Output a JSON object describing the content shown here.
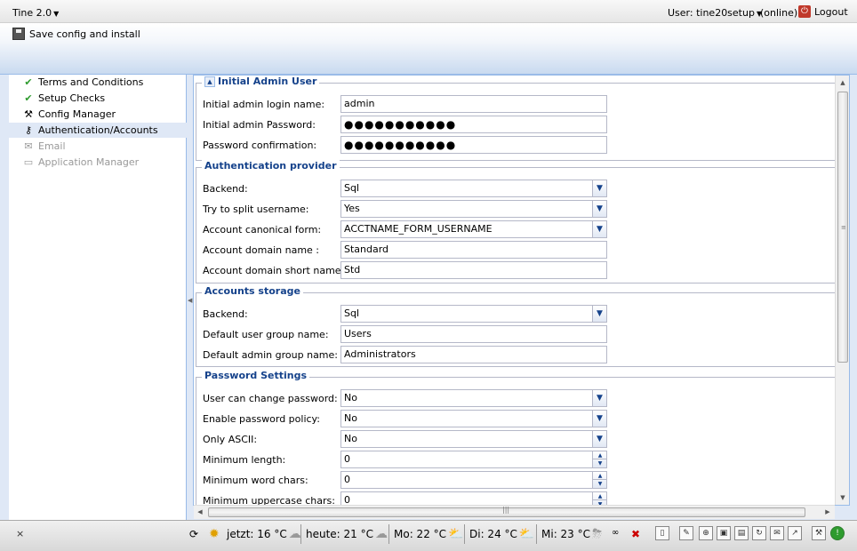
{
  "topbar": {
    "app_menu": "Tine 2.0",
    "user_menu": "User: tine20setup",
    "online": "(online)",
    "logout": "Logout"
  },
  "toolbar": {
    "save_label": "Save config and install"
  },
  "sidebar": {
    "items": [
      {
        "label": "Terms and Conditions",
        "icon": "check-icon",
        "state": "done"
      },
      {
        "label": "Setup Checks",
        "icon": "check-icon",
        "state": "done"
      },
      {
        "label": "Config Manager",
        "icon": "tools-icon",
        "state": "normal"
      },
      {
        "label": "Authentication/Accounts",
        "icon": "key-icon",
        "state": "selected"
      },
      {
        "label": "Email",
        "icon": "email-icon",
        "state": "disabled"
      },
      {
        "label": "Application Manager",
        "icon": "monitor-icon",
        "state": "disabled"
      }
    ]
  },
  "form": {
    "admin": {
      "legend": "Initial Admin User",
      "login_label": "Initial admin login name:",
      "login_value": "admin",
      "password_label": "Initial admin Password:",
      "password_value": "●●●●●●●●●●●",
      "confirm_label": "Password confirmation:",
      "confirm_value": "●●●●●●●●●●●"
    },
    "auth": {
      "legend": "Authentication provider",
      "backend_label": "Backend:",
      "backend_value": "Sql",
      "split_label": "Try to split username:",
      "split_value": "Yes",
      "canonical_label": "Account canonical form:",
      "canonical_value": "ACCTNAME_FORM_USERNAME",
      "domain_label": "Account domain name :",
      "domain_value": "Standard",
      "short_label": "Account domain short name:",
      "short_value": "Std"
    },
    "storage": {
      "legend": "Accounts storage",
      "backend_label": "Backend:",
      "backend_value": "Sql",
      "user_group_label": "Default user group name:",
      "user_group_value": "Users",
      "admin_group_label": "Default admin group name:",
      "admin_group_value": "Administrators"
    },
    "password": {
      "legend": "Password Settings",
      "change_label": "User can change password:",
      "change_value": "No",
      "policy_label": "Enable password policy:",
      "policy_value": "No",
      "ascii_label": "Only ASCII:",
      "ascii_value": "No",
      "min_length_label": "Minimum length:",
      "min_length_value": "0",
      "min_word_label": "Minimum word chars:",
      "min_word_value": "0",
      "min_upper_label": "Minimum uppercase chars:",
      "min_upper_value": "0"
    }
  },
  "statusbar": {
    "close": "×",
    "now": "jetzt: 16 °C",
    "today": "heute: 21 °C",
    "mo": "Mo: 22 °C",
    "di": "Di: 24 °C",
    "mi": "Mi: 23 °C"
  }
}
